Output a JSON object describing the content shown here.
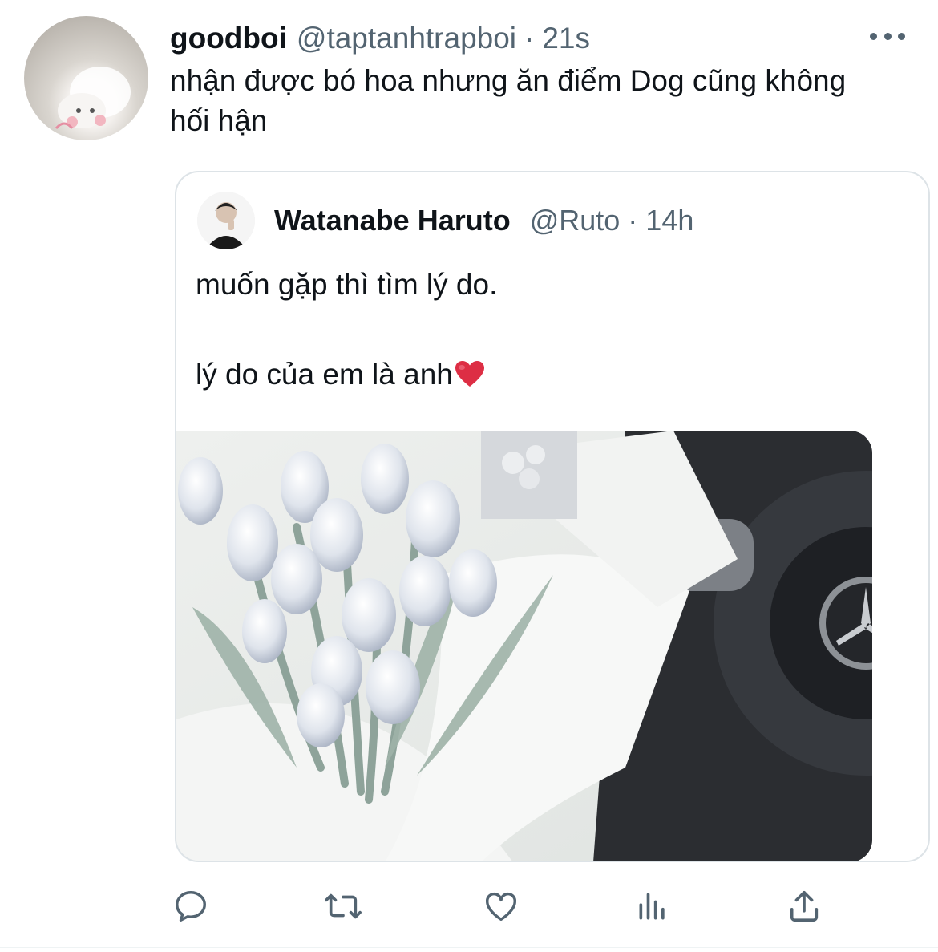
{
  "tweet": {
    "display_name": "goodboi",
    "handle": "@taptanhtrapboi",
    "separator": "·",
    "time": "21s",
    "text": "nhận được bó hoa nhưng ăn điểm Dog cũng không hối hận",
    "avatar_icon": "cat-avatar-icon",
    "more_icon": "more-dots-icon"
  },
  "quoted_tweet": {
    "display_name": "Watanabe Haruto",
    "handle": "@Ruto",
    "separator": "·",
    "time": "14h",
    "lines": [
      "muốn gặp thì tìm lý do.",
      "lý do của em là anh"
    ],
    "emoji": "heart-emoji",
    "media_icon": "tulip-bouquet-photo"
  },
  "actions": [
    {
      "icon": "reply-icon"
    },
    {
      "icon": "retweet-icon"
    },
    {
      "icon": "like-icon"
    },
    {
      "icon": "analytics-icon"
    },
    {
      "icon": "share-icon"
    }
  ],
  "colors": {
    "text_primary": "#0f1419",
    "text_secondary": "#536471",
    "border": "#dde3e7",
    "heart": "#e0245e"
  }
}
